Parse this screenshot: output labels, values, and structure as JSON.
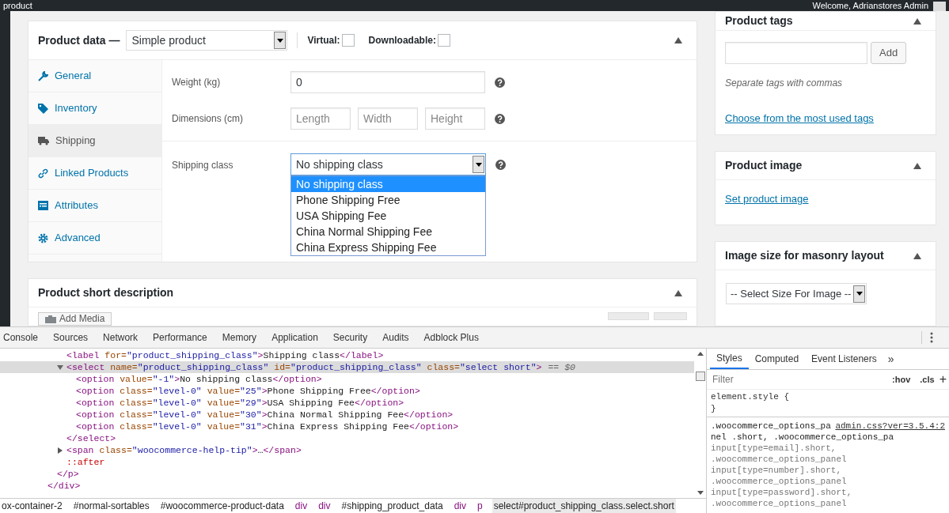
{
  "admin_bar": {
    "title": "product",
    "welcome": "Welcome, Adrianstores Admin"
  },
  "product_data": {
    "title": "Product data —",
    "type": "Simple product",
    "virtual": {
      "label": "Virtual:",
      "checked": false
    },
    "downloadable": {
      "label": "Downloadable:",
      "checked": false
    },
    "tabs": [
      {
        "label": "General",
        "selected": false
      },
      {
        "label": "Inventory",
        "selected": false
      },
      {
        "label": "Shipping",
        "selected": true
      },
      {
        "label": "Linked Products",
        "selected": false
      },
      {
        "label": "Attributes",
        "selected": false
      },
      {
        "label": "Advanced",
        "selected": false
      }
    ],
    "weight": {
      "label": "Weight (kg)",
      "value": "0"
    },
    "dimensions": {
      "label": "Dimensions (cm)",
      "fields": [
        {
          "placeholder": "Length"
        },
        {
          "placeholder": "Width"
        },
        {
          "placeholder": "Height"
        }
      ]
    },
    "shipping_class": {
      "label": "Shipping class",
      "value": "No shipping class",
      "expanded": true,
      "options": [
        {
          "label": "No shipping class",
          "selected": true
        },
        {
          "label": "Phone Shipping Free",
          "selected": false
        },
        {
          "label": "USA Shipping Fee",
          "selected": false
        },
        {
          "label": "China Normal Shipping Fee",
          "selected": false
        },
        {
          "label": "China Express Shipping Fee",
          "selected": false
        }
      ]
    }
  },
  "short_description": {
    "title": "Product short description",
    "add_media": "Add Media"
  },
  "product_tags": {
    "title": "Product tags",
    "button": "Add",
    "hint": "Separate tags with commas",
    "link": "Choose from the most used tags"
  },
  "product_image": {
    "title": "Product image",
    "link": "Set product image"
  },
  "image_size": {
    "title": "Image size for masonry layout",
    "select": "-- Select Size For Image --"
  },
  "devtools": {
    "tabs": [
      {
        "label": "Console",
        "selected": false
      },
      {
        "label": "Sources",
        "selected": false
      },
      {
        "label": "Network",
        "selected": false
      },
      {
        "label": "Performance",
        "selected": false
      },
      {
        "label": "Memory",
        "selected": false
      },
      {
        "label": "Application",
        "selected": false
      },
      {
        "label": "Security",
        "selected": false
      },
      {
        "label": "Audits",
        "selected": false
      },
      {
        "label": "Adblock Plus",
        "selected": false
      }
    ],
    "dom": [
      {
        "children": [
          {
            "children": [
              {
                "text": "<label for=\"product_shipping_class\">Shipping class</label>",
                "selected": false
              },
              {
                "text": "<select name=\"product_shipping_class\" id=\"product_shipping_class\" class=\"select short\">",
                "suffix": "== $0",
                "selected": true,
                "expanded": true,
                "children": [
                  {
                    "text": "<option value=\"-1\">No shipping class</option>",
                    "selected": false
                  },
                  {
                    "text": "<option class=\"level-0\" value=\"25\">Phone Shipping Free</option>",
                    "selected": false
                  },
                  {
                    "text": "<option class=\"level-0\" value=\"29\">USA Shipping Fee</option>",
                    "selected": false
                  },
                  {
                    "text": "<option class=\"level-0\" value=\"30\">China Normal Shipping Fee</option>",
                    "selected": false
                  },
                  {
                    "text": "<option class=\"level-0\" value=\"31\">China Express Shipping Fee</option>",
                    "selected": false
                  }
                ]
              },
              {
                "text": "</select>",
                "selected": false
              },
              {
                "text": "<span class=\"woocommerce-help-tip\">…</span>",
                "selected": false,
                "expanded": false
              },
              {
                "text": "::after",
                "pseudo": true,
                "selected": false
              }
            ]
          },
          {
            "text": "</p>",
            "selected": false
          }
        ]
      },
      {
        "text": "</div>",
        "selected": false
      }
    ],
    "breadcrumbs": [
      {
        "label": "ox-container-2",
        "kind": "id",
        "selected": false
      },
      {
        "label": "#normal-sortables",
        "kind": "id",
        "selected": false
      },
      {
        "label": "#woocommerce-product-data",
        "kind": "id",
        "selected": false
      },
      {
        "label": "div",
        "kind": "tag",
        "selected": false
      },
      {
        "label": "div",
        "kind": "tag",
        "selected": false
      },
      {
        "label": "#shipping_product_data",
        "kind": "id",
        "selected": false
      },
      {
        "label": "div",
        "kind": "tag",
        "selected": false
      },
      {
        "label": "p",
        "kind": "tag",
        "selected": false
      },
      {
        "label": "select#product_shipping_class.select.short",
        "kind": "id",
        "selected": true
      }
    ],
    "styles": {
      "tabs": [
        {
          "label": "Styles",
          "selected": true
        },
        {
          "label": "Computed",
          "selected": false
        },
        {
          "label": "Event Listeners",
          "selected": false
        }
      ],
      "more": "»",
      "filter_placeholder": "Filter",
      "hov": ":hov",
      "cls": ".cls",
      "add": "+",
      "element_style": [
        "element.style {",
        "}"
      ],
      "rule_source": "admin.css?ver=3.5.4:2",
      "rule_lines": [
        ".woocommerce_options_pa",
        "nel .short, .woocommerce_options_pa",
        "input[type=email].short,",
        ".woocommerce_options_panel",
        "input[type=number].short,",
        ".woocommerce_options_panel",
        "input[type=password].short,",
        ".woocommerce_options_panel"
      ]
    }
  }
}
